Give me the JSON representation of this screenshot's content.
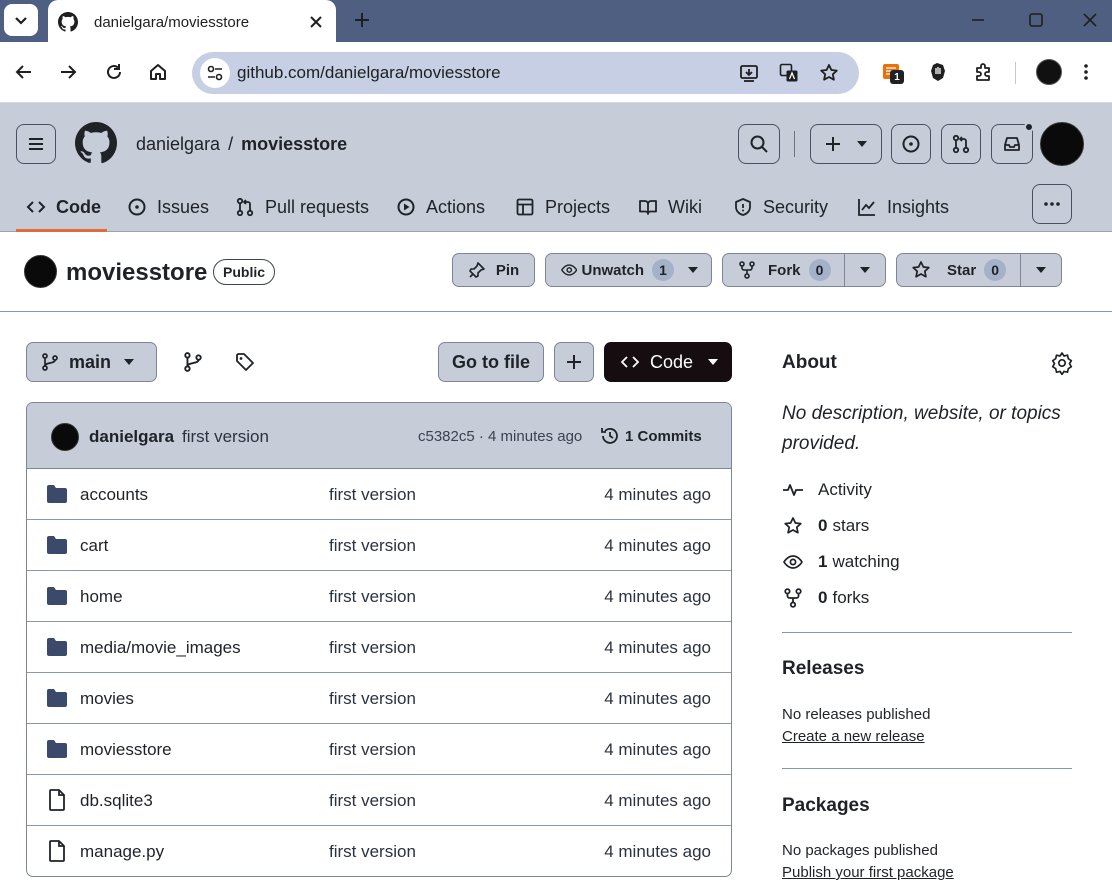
{
  "browser": {
    "tab_title": "danielgara/moviesstore",
    "url": "github.com/danielgara/moviesstore",
    "extension_badge": "1"
  },
  "header": {
    "owner": "danielgara",
    "separator": "/",
    "repo": "moviesstore"
  },
  "nav": {
    "items": [
      {
        "label": "Code",
        "icon": "code-icon",
        "active": true
      },
      {
        "label": "Issues",
        "icon": "issue-icon"
      },
      {
        "label": "Pull requests",
        "icon": "pull-request-icon"
      },
      {
        "label": "Actions",
        "icon": "play-icon"
      },
      {
        "label": "Projects",
        "icon": "table-icon"
      },
      {
        "label": "Wiki",
        "icon": "book-icon"
      },
      {
        "label": "Security",
        "icon": "shield-icon"
      },
      {
        "label": "Insights",
        "icon": "graph-icon"
      }
    ]
  },
  "repo": {
    "name": "moviesstore",
    "visibility": "Public",
    "pin_label": "Pin",
    "watch_label": "Unwatch",
    "watch_count": "1",
    "fork_label": "Fork",
    "fork_count": "0",
    "star_label": "Star",
    "star_count": "0"
  },
  "files_toolbar": {
    "branch": "main",
    "go_to_file": "Go to file",
    "code_button": "Code"
  },
  "latest_commit": {
    "author": "danielgara",
    "message": "first version",
    "meta": "c5382c5 · 4 minutes ago",
    "commits_label": "1 Commits"
  },
  "files": [
    {
      "name": "accounts",
      "type": "dir",
      "commit": "first version",
      "time": "4 minutes ago"
    },
    {
      "name": "cart",
      "type": "dir",
      "commit": "first version",
      "time": "4 minutes ago"
    },
    {
      "name": "home",
      "type": "dir",
      "commit": "first version",
      "time": "4 minutes ago"
    },
    {
      "name": "media/movie_images",
      "type": "dir",
      "commit": "first version",
      "time": "4 minutes ago"
    },
    {
      "name": "movies",
      "type": "dir",
      "commit": "first version",
      "time": "4 minutes ago"
    },
    {
      "name": "moviesstore",
      "type": "dir",
      "commit": "first version",
      "time": "4 minutes ago"
    },
    {
      "name": "db.sqlite3",
      "type": "file",
      "commit": "first version",
      "time": "4 minutes ago"
    },
    {
      "name": "manage.py",
      "type": "file",
      "commit": "first version",
      "time": "4 minutes ago"
    }
  ],
  "about": {
    "title": "About",
    "description": "No description, website, or topics provided.",
    "activity": "Activity",
    "stars_count": "0",
    "stars_label": "stars",
    "watching_count": "1",
    "watching_label": "watching",
    "forks_count": "0",
    "forks_label": "forks"
  },
  "releases": {
    "title": "Releases",
    "text": "No releases published",
    "link": "Create a new release"
  },
  "packages": {
    "title": "Packages",
    "text": "No packages published",
    "link": "Publish your first package"
  }
}
